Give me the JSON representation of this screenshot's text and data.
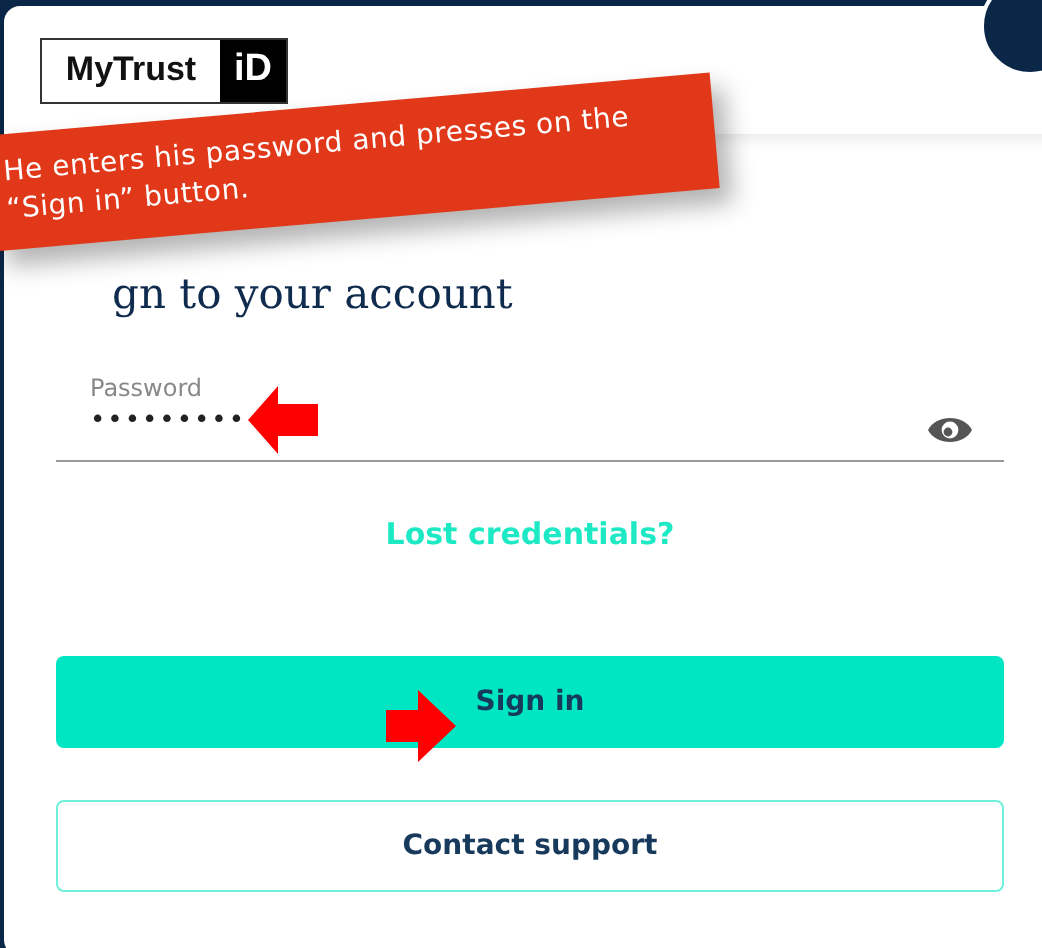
{
  "logo": {
    "text": "MyTrust",
    "mark": "iD"
  },
  "callout": {
    "text": "He enters his password and presses on the “Sign in” button."
  },
  "heading": "gn to your account",
  "field": {
    "label": "Password",
    "value": "•••••••••"
  },
  "link": "Lost credentials?",
  "buttons": [
    {
      "label": "Sign in",
      "kind": "primary"
    },
    {
      "label": "Contact support",
      "kind": "secondary"
    }
  ]
}
